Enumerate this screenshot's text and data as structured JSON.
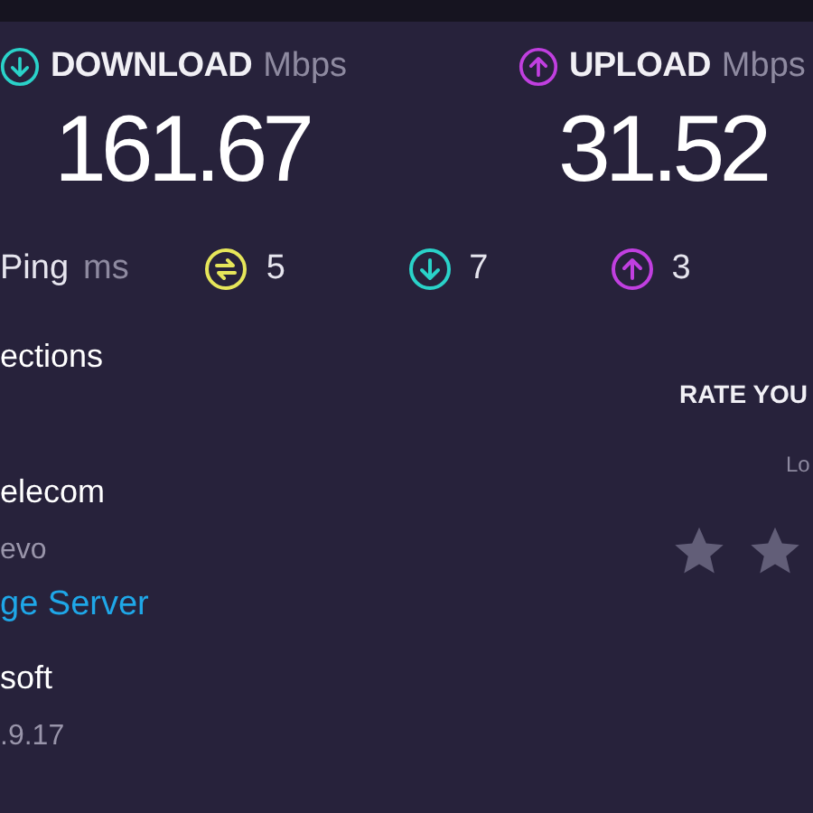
{
  "download": {
    "kind": "download",
    "label": "DOWNLOAD",
    "unit": "Mbps",
    "value": "161.67"
  },
  "upload": {
    "kind": "upload",
    "label": "UPLOAD",
    "unit": "Mbps",
    "value": "31.52"
  },
  "ping": {
    "label": "Ping",
    "unit": "ms",
    "stats": [
      {
        "kind": "idle",
        "value": "5"
      },
      {
        "kind": "download",
        "value": "7"
      },
      {
        "kind": "upload",
        "value": "3"
      }
    ]
  },
  "connections": {
    "title": "ections"
  },
  "provider": {
    "name": "elecom",
    "location": "evo"
  },
  "server": {
    "link": "ge Server",
    "name": "soft",
    "location": ".9.17"
  },
  "rating": {
    "title": "RATE YOU",
    "scale_label": "Lo"
  }
}
